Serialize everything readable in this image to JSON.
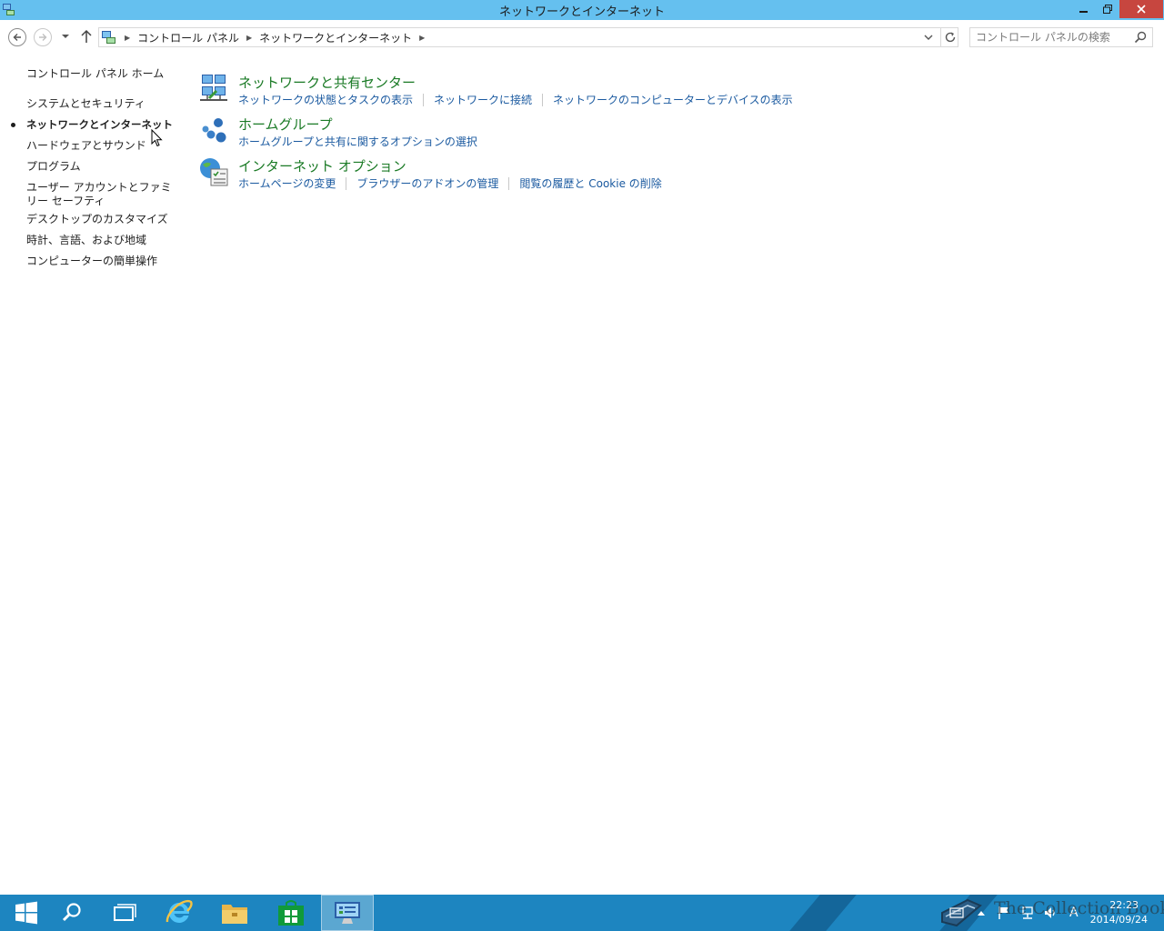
{
  "window": {
    "title": "ネットワークとインターネット",
    "minimize_icon": "minimize-icon",
    "restore_icon": "restore-icon",
    "close_icon": "close-icon"
  },
  "address_bar": {
    "crumbs": [
      "コントロール パネル",
      "ネットワークとインターネット"
    ],
    "search_placeholder": "コントロール パネルの検索"
  },
  "left_nav": {
    "home": "コントロール パネル ホーム",
    "items": [
      "システムとセキュリティ",
      "ネットワークとインターネット",
      "ハードウェアとサウンド",
      "プログラム",
      "ユーザー アカウントとファミリー セーフティ",
      "デスクトップのカスタマイズ",
      "時計、言語、および地域",
      "コンピューターの簡単操作"
    ],
    "active_index": 1
  },
  "categories": [
    {
      "title": "ネットワークと共有センター",
      "icon": "network-sharing-center-icon",
      "links": [
        "ネットワークの状態とタスクの表示",
        "ネットワークに接続",
        "ネットワークのコンピューターとデバイスの表示"
      ]
    },
    {
      "title": "ホームグループ",
      "icon": "homegroup-icon",
      "links": [
        "ホームグループと共有に関するオプションの選択"
      ]
    },
    {
      "title": "インターネット オプション",
      "icon": "internet-options-icon",
      "links": [
        "ホームページの変更",
        "ブラウザーのアドオンの管理",
        "閲覧の履歴と Cookie の削除"
      ]
    }
  ],
  "taskbar": {
    "buttons": [
      "start-icon",
      "search-icon",
      "task-view-icon",
      "internet-explorer-icon",
      "file-explorer-icon",
      "store-icon",
      "control-panel-icon"
    ],
    "watermark": "The Collection Book",
    "ime_indicator": "A",
    "time": "22:23",
    "date": "2014/09/24"
  },
  "colors": {
    "titlebar": "#65c0ef",
    "close_button": "#c7463f",
    "category_title": "#1a7a25",
    "link": "#1b5aa0",
    "taskbar": "#1d85c0"
  }
}
